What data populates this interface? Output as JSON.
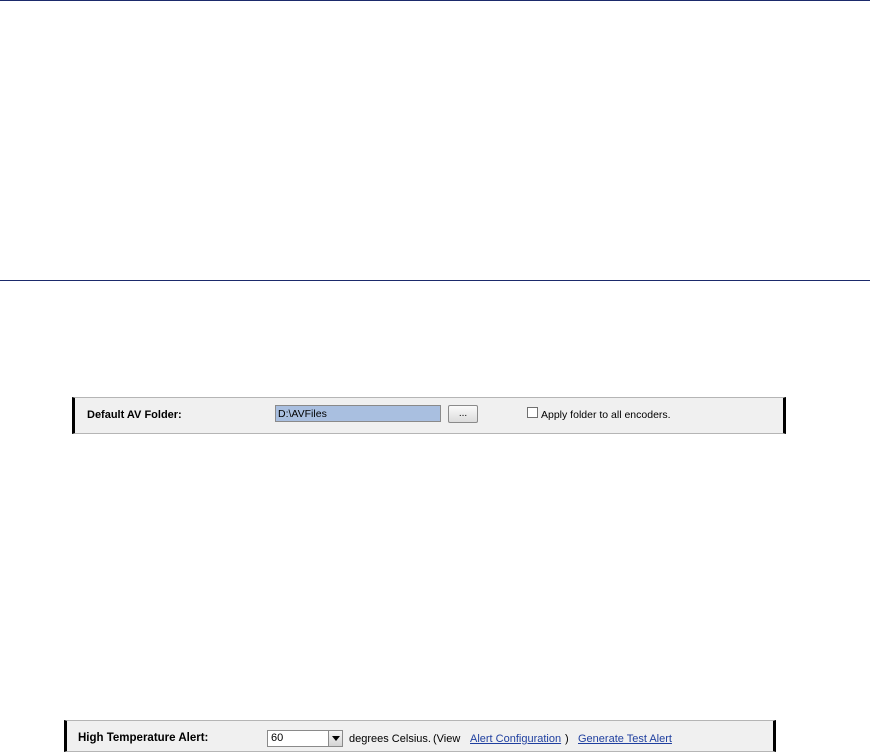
{
  "av_folder": {
    "label": "Default AV Folder:",
    "path_value": "D:\\AVFiles",
    "browse_label": "...",
    "apply_checked": false,
    "apply_label": "Apply folder to all encoders."
  },
  "temperature_alert": {
    "label": "High Temperature Alert:",
    "selected_value": "60",
    "units_text": "degrees Celsius.",
    "view_prefix": "(View",
    "alert_config_link": "Alert Configuration",
    "view_suffix": ")",
    "test_alert_link": "Generate Test Alert"
  },
  "colors": {
    "rule_line": "#1b2a6b",
    "panel_bg": "#f0f0f0",
    "selected_input_bg": "#a9bfe0",
    "link": "#1f3f9f"
  }
}
